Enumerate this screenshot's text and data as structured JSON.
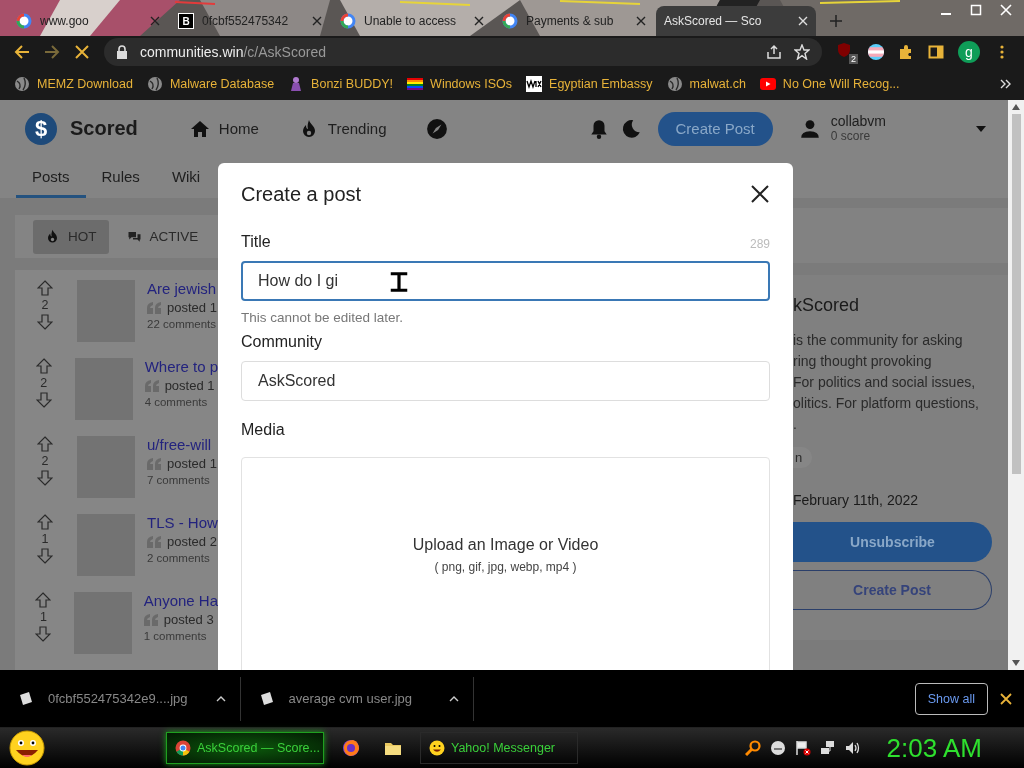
{
  "browser": {
    "tabs": [
      {
        "title": "www.goo",
        "kind": "ring",
        "selected": false
      },
      {
        "title": "0fcbf552475342",
        "kind": "letter",
        "favicon_letter": "B",
        "selected": false
      },
      {
        "title": "Unable to access",
        "kind": "ring",
        "selected": false
      },
      {
        "title": "Payments & sub",
        "kind": "ring",
        "selected": false
      },
      {
        "title": "AskScored — Sco",
        "kind": "plain",
        "selected": true
      }
    ],
    "loading": true,
    "address": {
      "host": "communities.win",
      "path": "/c/AskScored"
    },
    "extension_badge": "2",
    "profile_initial": "g",
    "bookmarks": [
      {
        "label": "MEMZ Download",
        "kind": "globe"
      },
      {
        "label": "Malware Database",
        "kind": "globe"
      },
      {
        "label": "Bonzi BUDDY!",
        "kind": "figure"
      },
      {
        "label": "Windows ISOs",
        "kind": "rainbow"
      },
      {
        "label": "Egyptian Embassy",
        "kind": "zigzag"
      },
      {
        "label": "malwat.ch",
        "kind": "globe"
      },
      {
        "label": "No One Will Recog...",
        "kind": "play"
      }
    ]
  },
  "site": {
    "logo_mark": "$",
    "name": "Scored",
    "nav": [
      {
        "label": "Home",
        "kind": "home"
      },
      {
        "label": "Trending",
        "kind": "fire"
      }
    ],
    "create_post": "Create Post",
    "user": {
      "name": "collabvm",
      "score": "0 score"
    },
    "tabs": [
      {
        "label": "Posts",
        "selected": true
      },
      {
        "label": "Rules",
        "selected": false
      },
      {
        "label": "Wiki",
        "selected": false
      }
    ],
    "sort": [
      {
        "label": "HOT",
        "kind": "fire",
        "selected": true
      },
      {
        "label": "ACTIVE",
        "kind": "chat",
        "selected": false
      }
    ],
    "posts": [
      {
        "votes": "2",
        "title": "Are jewish",
        "meta": "posted 1",
        "comments": "22 comments"
      },
      {
        "votes": "2",
        "title": "Where to p",
        "meta": "posted 1",
        "comments": "4 comments"
      },
      {
        "votes": "2",
        "title": "u/free-will",
        "meta": "posted 1",
        "comments": "7 comments"
      },
      {
        "votes": "1",
        "title": "TLS - How",
        "meta": "posted 2",
        "comments": "2 comments"
      },
      {
        "votes": "1",
        "title": "Anyone Ha",
        "meta": "posted 3",
        "comments": "1 comments"
      }
    ],
    "sidebar": {
      "title": "kScored",
      "lines": [
        "is the community for asking",
        "ring thought provoking",
        "For politics and social issues,",
        "olitics. For platform questions,",
        "."
      ],
      "tag": "n",
      "created": "February 11th, 2022",
      "buttons": [
        {
          "label": "Unsubscribe",
          "kind": "filled"
        },
        {
          "label": "Create Post",
          "kind": "outlined"
        }
      ]
    }
  },
  "modal": {
    "title": "Create a post",
    "fields": [
      {
        "label": "Title",
        "counter": "289",
        "value": "How do I gi",
        "focused": true,
        "help": "This cannot be edited later."
      },
      {
        "label": "Community",
        "value": "AskScored",
        "focused": false
      }
    ],
    "media": {
      "label": "Media",
      "prompt": "Upload an Image or Video",
      "formats": "( png, gif, jpg, webp, mp4 )"
    }
  },
  "downloads": {
    "items": [
      {
        "name": "0fcbf552475342e9....jpg"
      },
      {
        "name": "average cvm user.jpg"
      }
    ],
    "show_all": "Show all"
  },
  "taskbar": {
    "tasks": [
      {
        "kind": "chrome",
        "label": "AskScored — Score...",
        "selected": true
      },
      {
        "kind": "firefox",
        "selected": false
      },
      {
        "kind": "folder",
        "selected": false
      },
      {
        "kind": "smiley",
        "label": "Yahoo! Messenger",
        "selected": false
      }
    ],
    "clock": "2:03 AM"
  }
}
